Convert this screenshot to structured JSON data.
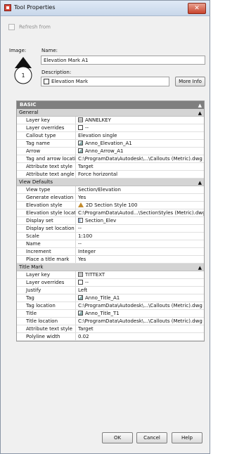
{
  "window": {
    "title": "Tool Properties",
    "close_glyph": "✕"
  },
  "refresh": {
    "label": "Refresh from"
  },
  "image": {
    "label": "Image:",
    "preview_number": "1"
  },
  "name": {
    "label": "Name:",
    "value": "Elevation Mark A1"
  },
  "description": {
    "label": "Description:",
    "value": "Elevation Mark"
  },
  "more_info": {
    "label": "More Info"
  },
  "grid": {
    "basic_label": "BASIC",
    "collapse_glyph": "▲",
    "general": {
      "title": "General",
      "rows": [
        {
          "key": "Layer key",
          "value": "ANNELKEY",
          "icon": "layer-icon"
        },
        {
          "key": "Layer overrides",
          "value": "--",
          "icon": "box-icon"
        },
        {
          "key": "Callout type",
          "value": "Elevation single"
        },
        {
          "key": "Tag name",
          "value": "Anno_Elevation_A1",
          "icon": "tag-icon"
        },
        {
          "key": "Arrow",
          "value": "Anno_Arrow_A1",
          "icon": "tag-icon"
        },
        {
          "key": "Tag and arrow location",
          "value": "C:\\ProgramData\\Autodesk\\...\\Callouts (Metric).dwg"
        },
        {
          "key": "Attribute text style",
          "value": "Target"
        },
        {
          "key": "Attribute text angle",
          "value": "Force horizontal"
        }
      ]
    },
    "view_defaults": {
      "title": "View Defaults",
      "rows": [
        {
          "key": "View type",
          "value": "Section/Elevation"
        },
        {
          "key": "Generate elevation",
          "value": "Yes"
        },
        {
          "key": "Elevation style",
          "value": "2D Section Style 100",
          "icon": "style-icon"
        },
        {
          "key": "Elevation style location",
          "value": "C:\\ProgramData\\Autod...\\SectionStyles (Metric).dwg"
        },
        {
          "key": "Display set",
          "value": "Section_Elev",
          "icon": "display-icon"
        },
        {
          "key": "Display set location",
          "value": "--"
        },
        {
          "key": "Scale",
          "value": "1:100"
        },
        {
          "key": "Name",
          "value": "--"
        },
        {
          "key": "Increment",
          "value": "Integer"
        },
        {
          "key": "Place a title mark",
          "value": "Yes"
        }
      ]
    },
    "title_mark": {
      "title": "Title Mark",
      "rows": [
        {
          "key": "Layer key",
          "value": "TITTEXT",
          "icon": "layer-icon"
        },
        {
          "key": "Layer overrides",
          "value": "--",
          "icon": "box-icon"
        },
        {
          "key": "Justify",
          "value": "Left"
        },
        {
          "key": "Tag",
          "value": "Anno_Title_A1",
          "icon": "tag-icon"
        },
        {
          "key": "Tag location",
          "value": "C:\\ProgramData\\Autodesk\\...\\Callouts (Metric).dwg"
        },
        {
          "key": "Title",
          "value": "Anno_Title_T1",
          "icon": "tag-icon"
        },
        {
          "key": "Title location",
          "value": "C:\\ProgramData\\Autodesk\\...\\Callouts (Metric).dwg"
        },
        {
          "key": "Attribute text style",
          "value": "Target"
        },
        {
          "key": "Polyline width",
          "value": "0.02"
        }
      ]
    }
  },
  "buttons": {
    "ok": "OK",
    "cancel": "Cancel",
    "help": "Help"
  }
}
